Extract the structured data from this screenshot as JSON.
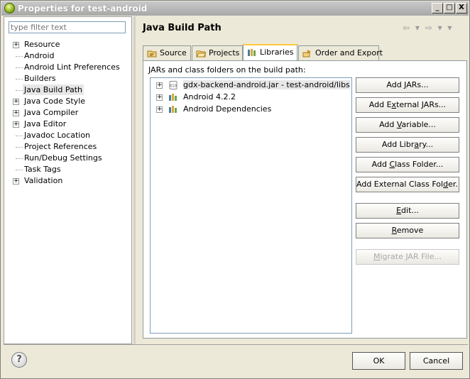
{
  "window": {
    "title": "Properties for test-android",
    "controls": {
      "minimize": "_",
      "maximize": "□",
      "close": "X"
    }
  },
  "filter": {
    "placeholder": "type filter text"
  },
  "tree": {
    "items": [
      {
        "label": "Resource",
        "expandable": true
      },
      {
        "label": "Android",
        "expandable": false
      },
      {
        "label": "Android Lint Preferences",
        "expandable": false
      },
      {
        "label": "Builders",
        "expandable": false
      },
      {
        "label": "Java Build Path",
        "expandable": false,
        "selected": true
      },
      {
        "label": "Java Code Style",
        "expandable": true
      },
      {
        "label": "Java Compiler",
        "expandable": true
      },
      {
        "label": "Java Editor",
        "expandable": true
      },
      {
        "label": "Javadoc Location",
        "expandable": false
      },
      {
        "label": "Project References",
        "expandable": false
      },
      {
        "label": "Run/Debug Settings",
        "expandable": false
      },
      {
        "label": "Task Tags",
        "expandable": false
      },
      {
        "label": "Validation",
        "expandable": true
      }
    ]
  },
  "page": {
    "title": "Java Build Path",
    "nav": "⇦ ▾ ⇨ ▾ ▾"
  },
  "tabs": [
    {
      "label": "Source",
      "icon": "source-folder-icon"
    },
    {
      "label": "Projects",
      "icon": "projects-folder-icon"
    },
    {
      "label": "Libraries",
      "icon": "libraries-icon",
      "active": true
    },
    {
      "label": "Order and Export",
      "icon": "order-export-icon"
    }
  ],
  "libraries": {
    "caption": "JARs and class folders on the build path:",
    "entries": [
      {
        "label": "gdx-backend-android.jar - test-android/libs",
        "icon": "jar-icon"
      },
      {
        "label": "Android 4.2.2",
        "icon": "library-icon"
      },
      {
        "label": "Android Dependencies",
        "icon": "library-icon"
      }
    ]
  },
  "buttons": {
    "add_jars": {
      "pre": "Add ",
      "u": "J",
      "post": "ARs..."
    },
    "add_external_jars": {
      "pre": "Add E",
      "u": "x",
      "post": "ternal JARs..."
    },
    "add_variable": {
      "pre": "Add ",
      "u": "V",
      "post": "ariable..."
    },
    "add_library": {
      "pre": "Add Libr",
      "u": "a",
      "post": "ry..."
    },
    "add_class_folder": {
      "pre": "Add ",
      "u": "C",
      "post": "lass Folder..."
    },
    "add_external_class_folder": {
      "pre": "Add External Class Fol",
      "u": "d",
      "post": "er..."
    },
    "edit": {
      "pre": "",
      "u": "E",
      "post": "dit..."
    },
    "remove": {
      "pre": "",
      "u": "R",
      "post": "emove"
    },
    "migrate": {
      "pre": "",
      "u": "M",
      "post": "igrate JAR File..."
    }
  },
  "footer": {
    "help": "?",
    "ok": "OK",
    "cancel": "Cancel"
  }
}
